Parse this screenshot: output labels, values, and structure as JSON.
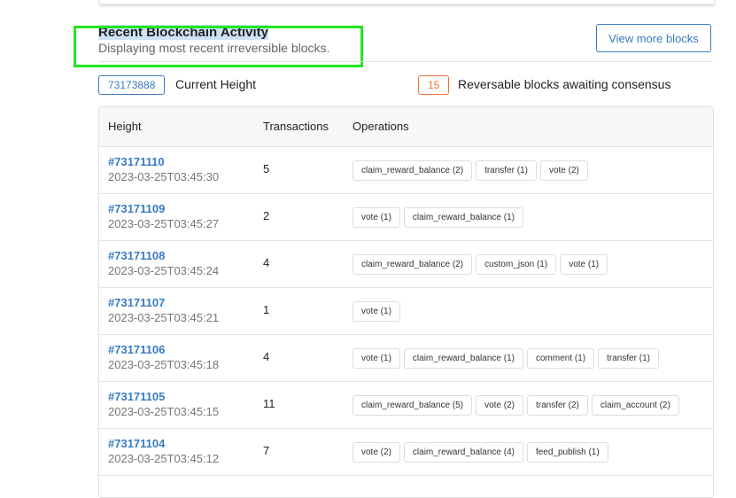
{
  "header": {
    "title": "Recent Blockchain Activity",
    "subtitle": "Displaying most recent irreversible blocks.",
    "view_more": "View more blocks"
  },
  "stats": {
    "current_height": "73173888",
    "current_height_label": "Current Height",
    "reversible": "15",
    "reversible_label": "Reversable blocks awaiting consensus"
  },
  "colors": {
    "accent": "#3a7bbf",
    "warning": "#e8743b",
    "annotation": "#22e622"
  },
  "table": {
    "headers": [
      "Height",
      "Transactions",
      "Operations"
    ],
    "rows": [
      {
        "height": "#73171110",
        "time": "2023-03-25T03:45:30",
        "tx": "5",
        "ops": [
          "claim_reward_balance (2)",
          "transfer (1)",
          "vote (2)"
        ]
      },
      {
        "height": "#73171109",
        "time": "2023-03-25T03:45:27",
        "tx": "2",
        "ops": [
          "vote (1)",
          "claim_reward_balance (1)"
        ]
      },
      {
        "height": "#73171108",
        "time": "2023-03-25T03:45:24",
        "tx": "4",
        "ops": [
          "claim_reward_balance (2)",
          "custom_json (1)",
          "vote (1)"
        ]
      },
      {
        "height": "#73171107",
        "time": "2023-03-25T03:45:21",
        "tx": "1",
        "ops": [
          "vote (1)"
        ]
      },
      {
        "height": "#73171106",
        "time": "2023-03-25T03:45:18",
        "tx": "4",
        "ops": [
          "vote (1)",
          "claim_reward_balance (1)",
          "comment (1)",
          "transfer (1)"
        ]
      },
      {
        "height": "#73171105",
        "time": "2023-03-25T03:45:15",
        "tx": "11",
        "ops": [
          "claim_reward_balance (5)",
          "vote (2)",
          "transfer (2)",
          "claim_account (2)"
        ]
      },
      {
        "height": "#73171104",
        "time": "2023-03-25T03:45:12",
        "tx": "7",
        "ops": [
          "vote (2)",
          "claim_reward_balance (4)",
          "feed_publish (1)"
        ]
      }
    ]
  }
}
